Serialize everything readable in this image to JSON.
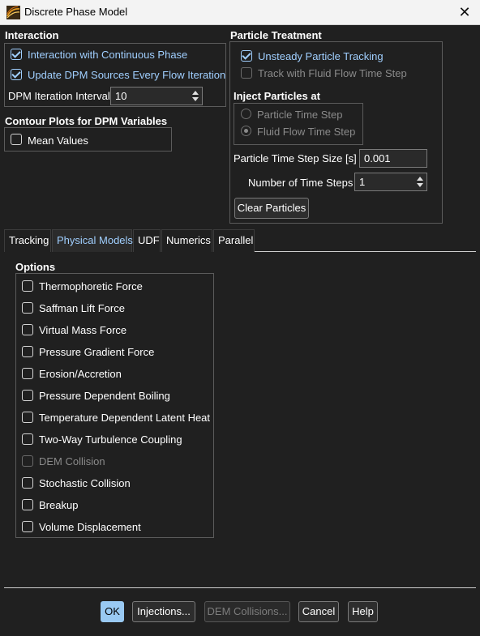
{
  "window": {
    "title": "Discrete Phase Model",
    "close_glyph": "✕"
  },
  "interaction": {
    "title": "Interaction",
    "interaction_continuous": {
      "label": "Interaction with Continuous Phase",
      "checked": true
    },
    "update_dpm_sources": {
      "label": "Update DPM Sources Every Flow Iteration",
      "checked": true
    },
    "iteration_interval": {
      "label": "DPM Iteration Interval",
      "value": "10"
    }
  },
  "contour": {
    "title": "Contour Plots for DPM Variables",
    "mean_values": {
      "label": "Mean Values",
      "checked": false
    }
  },
  "particle_treatment": {
    "title": "Particle Treatment",
    "unsteady": {
      "label": "Unsteady Particle Tracking",
      "checked": true
    },
    "track_fluid": {
      "label": "Track with Fluid Flow Time Step",
      "checked": false
    },
    "inject_title": "Inject Particles at",
    "inject_particle_ts": {
      "label": "Particle Time Step",
      "selected": false
    },
    "inject_fluid_ts": {
      "label": "Fluid Flow Time Step",
      "selected": true
    },
    "time_step_size": {
      "label": "Particle Time Step Size [s]",
      "value": "0.001"
    },
    "num_time_steps": {
      "label": "Number of Time Steps",
      "value": "1"
    },
    "clear_button": "Clear Particles"
  },
  "tabs": [
    {
      "label": "Tracking",
      "active": false
    },
    {
      "label": "Physical Models",
      "active": true
    },
    {
      "label": "UDF",
      "active": false
    },
    {
      "label": "Numerics",
      "active": false
    },
    {
      "label": "Parallel",
      "active": false
    }
  ],
  "options": {
    "title": "Options",
    "items": [
      {
        "label": "Thermophoretic Force",
        "checked": false,
        "disabled": false
      },
      {
        "label": "Saffman Lift Force",
        "checked": false,
        "disabled": false
      },
      {
        "label": "Virtual Mass Force",
        "checked": false,
        "disabled": false
      },
      {
        "label": "Pressure Gradient Force",
        "checked": false,
        "disabled": false
      },
      {
        "label": "Erosion/Accretion",
        "checked": false,
        "disabled": false
      },
      {
        "label": "Pressure Dependent Boiling",
        "checked": false,
        "disabled": false
      },
      {
        "label": "Temperature Dependent Latent Heat",
        "checked": false,
        "disabled": false
      },
      {
        "label": "Two-Way Turbulence Coupling",
        "checked": false,
        "disabled": false
      },
      {
        "label": "DEM Collision",
        "checked": false,
        "disabled": true
      },
      {
        "label": "Stochastic Collision",
        "checked": false,
        "disabled": false
      },
      {
        "label": "Breakup",
        "checked": false,
        "disabled": false
      },
      {
        "label": "Volume Displacement",
        "checked": false,
        "disabled": false
      }
    ]
  },
  "buttons": {
    "ok": "OK",
    "injections": "Injections...",
    "dem_collisions": "DEM Collisions...",
    "cancel": "Cancel",
    "help": "Help"
  },
  "colors": {
    "background": "#202020",
    "accent": "#a0cfff",
    "ok_button": "#99c9f2",
    "titlebar": "#f3f3f3"
  }
}
